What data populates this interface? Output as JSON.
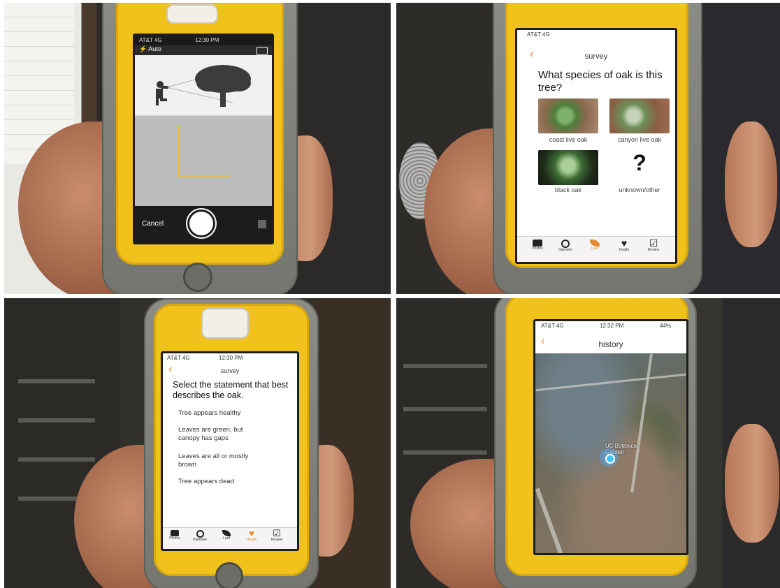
{
  "camera": {
    "status_carrier": "AT&T 4G",
    "status_time": "12:30 PM",
    "flash_label": "Auto",
    "cancel_label": "Cancel"
  },
  "species": {
    "status_carrier": "AT&T 4G",
    "title": "survey",
    "question": "What species of oak is this tree?",
    "options": [
      {
        "label": "coast live oak"
      },
      {
        "label": "canyon live oak"
      },
      {
        "label": "black oak"
      },
      {
        "label": "unknown/other",
        "glyph": "?"
      }
    ],
    "tabs": [
      "Photos",
      "Diameter",
      "Leaf",
      "Health",
      "Review"
    ]
  },
  "health": {
    "status_carrier": "AT&T 4G",
    "status_time": "12:30 PM",
    "title": "survey",
    "question": "Select the statement that best describes the oak.",
    "statements": [
      "Tree appears healthy",
      "Leaves are green, but canopy has gaps",
      "Leaves are all or mostly brown",
      "Tree appears dead"
    ],
    "tabs": [
      "Photos",
      "Diameter",
      "Leaf",
      "Health",
      "Review"
    ]
  },
  "history": {
    "status_carrier": "AT&T 4G",
    "status_time": "12:32 PM",
    "status_battery": "44%",
    "title": "history",
    "map_labels": [
      "UC Botanical Garden"
    ]
  },
  "colors": {
    "accent": "#e8892b",
    "case_yellow": "#f2c21c",
    "case_gray": "#7a7b75"
  },
  "icons": [
    "flash-icon",
    "camera-switch-icon",
    "back-chevron-icon",
    "camera-icon",
    "diameter-icon",
    "leaf-icon",
    "heart-icon",
    "checkbox-icon",
    "location-dot-icon"
  ]
}
